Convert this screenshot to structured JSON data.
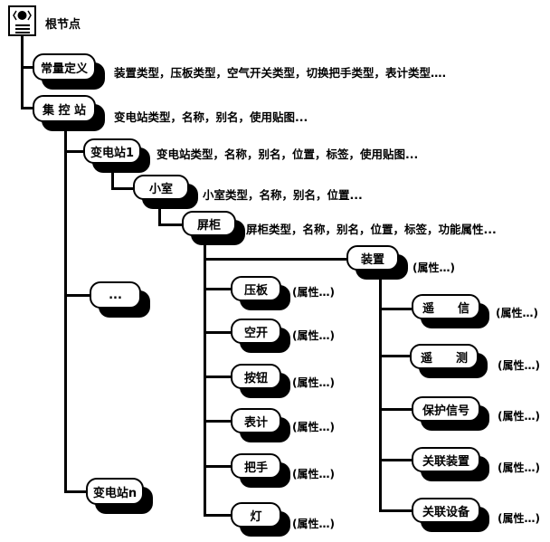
{
  "root": {
    "label": "根节点",
    "icon": "root-node-icon"
  },
  "constants": {
    "label": "常量定义",
    "desc": "装置类型，压板类型，空气开关类型，切换把手类型，表计类型…."
  },
  "master": {
    "label": "集 控 站",
    "desc": "变电站类型，名称，别名，使用贴图..."
  },
  "substation1": {
    "label": "变电站1",
    "desc": "变电站类型，名称，别名，位置，标签，使用贴图..."
  },
  "room": {
    "label": "小室",
    "desc": "小室类型，名称，别名，位置..."
  },
  "cabinet": {
    "label": "屏柜",
    "desc": "屏柜类型，名称，别名，位置，标签，功能属性..."
  },
  "ellipsis": {
    "label": "..."
  },
  "substationN": {
    "label": "变电站n"
  },
  "device": {
    "label": "装置",
    "attr": "(属性…)"
  },
  "cabinet_children": [
    {
      "label": "压板",
      "attr": "(属性…)"
    },
    {
      "label": "空开",
      "attr": "(属性…)"
    },
    {
      "label": "按钮",
      "attr": "(属性…)"
    },
    {
      "label": "表计",
      "attr": "(属性…)"
    },
    {
      "label": "把手",
      "attr": "(属性…)"
    },
    {
      "label": "灯",
      "attr": "(属性…)"
    }
  ],
  "device_children": [
    {
      "label": "遥　　信",
      "attr": "(属性…)"
    },
    {
      "label": "遥　　测",
      "attr": "(属性…)"
    },
    {
      "label": "保护信号",
      "attr": "(属性…)"
    },
    {
      "label": "关联装置",
      "attr": "(属性…)"
    },
    {
      "label": "关联设备",
      "attr": "(属性…)"
    }
  ]
}
